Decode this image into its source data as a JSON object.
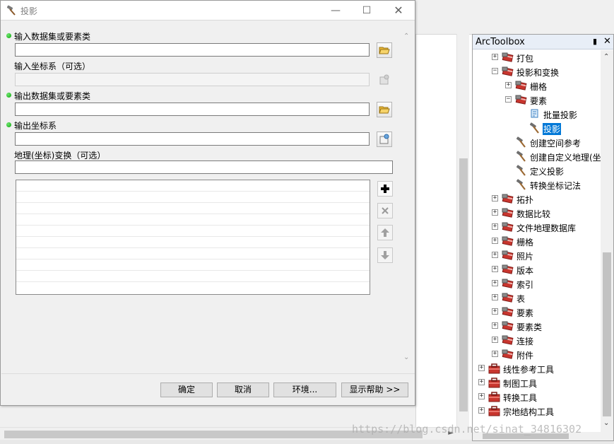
{
  "dialog": {
    "title": "投影",
    "fields": {
      "input_dataset_label": "输入数据集或要素类",
      "input_dataset_value": "",
      "input_cs_label": "输入坐标系（可选）",
      "input_cs_value": "",
      "output_dataset_label": "输出数据集或要素类",
      "output_dataset_value": "",
      "output_cs_label": "输出坐标系",
      "output_cs_value": "",
      "transform_label": "地理(坐标)变换（可选）",
      "transform_value": ""
    },
    "buttons": {
      "ok": "确定",
      "cancel": "取消",
      "environments": "环境...",
      "show_help": "显示帮助 >>"
    }
  },
  "toolbox": {
    "title": "ArcToolbox",
    "items": [
      {
        "label": "打包",
        "expander": "+"
      },
      {
        "label": "投影和变换",
        "expander": "−"
      },
      {
        "label": "栅格",
        "expander": "+"
      },
      {
        "label": "要素",
        "expander": "−"
      },
      {
        "label": "批量投影"
      },
      {
        "label": "投影",
        "selected": true
      },
      {
        "label": "创建空间参考"
      },
      {
        "label": "创建自定义地理(坐"
      },
      {
        "label": "定义投影"
      },
      {
        "label": "转换坐标记法"
      },
      {
        "label": "拓扑",
        "expander": "+"
      },
      {
        "label": "数据比较",
        "expander": "+"
      },
      {
        "label": "文件地理数据库",
        "expander": "+"
      },
      {
        "label": "栅格",
        "expander": "+"
      },
      {
        "label": "照片",
        "expander": "+"
      },
      {
        "label": "版本",
        "expander": "+"
      },
      {
        "label": "索引",
        "expander": "+"
      },
      {
        "label": "表",
        "expander": "+"
      },
      {
        "label": "要素",
        "expander": "+"
      },
      {
        "label": "要素类",
        "expander": "+"
      },
      {
        "label": "连接",
        "expander": "+"
      },
      {
        "label": "附件",
        "expander": "+"
      },
      {
        "label": "线性参考工具",
        "expander": "+"
      },
      {
        "label": "制图工具",
        "expander": "+"
      },
      {
        "label": "转换工具",
        "expander": "+"
      },
      {
        "label": "宗地结构工具",
        "expander": "+"
      }
    ]
  },
  "watermark": "https://blog.csdn.net/sinat_34816302",
  "colors": {
    "selection": "#0078d7",
    "required_dot": "#0aa20a",
    "toolbox_red": "#c8352e"
  },
  "icons": {
    "tool": "hammer-icon",
    "toolset": "toolset-icon",
    "toolbox": "toolbox-icon",
    "script": "script-icon",
    "browse": "open-folder-icon",
    "spatial_ref": "spatial-reference-icon"
  }
}
